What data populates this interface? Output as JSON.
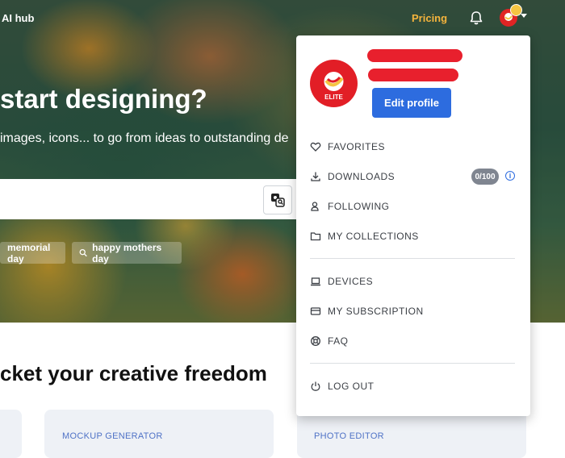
{
  "topbar": {
    "ai_hub": "AI hub",
    "pricing": "Pricing"
  },
  "hero": {
    "headline": "start designing?",
    "subhead": "images, icons... to go from ideas to outstanding de",
    "tags": [
      "memorial day",
      "happy mothers day"
    ]
  },
  "section": {
    "title": "cket your creative freedom",
    "cards": [
      "MOCKUP GENERATOR",
      "PHOTO EDITOR"
    ]
  },
  "profile_menu": {
    "logo_text": "ELITE",
    "edit_profile": "Edit profile",
    "items": {
      "favorites": "FAVORITES",
      "downloads": "DOWNLOADS",
      "downloads_quota": "0/100",
      "following": "FOLLOWING",
      "collections": "MY COLLECTIONS",
      "devices": "DEVICES",
      "subscription": "MY SUBSCRIPTION",
      "faq": "FAQ",
      "logout": "LOG OUT"
    }
  },
  "colors": {
    "accent_blue": "#2d6cdf",
    "pricing_gold": "#f5b43c",
    "brand_red": "#e21e26"
  },
  "icons": [
    "bell-icon",
    "heart-icon",
    "download-icon",
    "user-follow-icon",
    "folder-icon",
    "laptop-icon",
    "credit-card-icon",
    "lifebuoy-icon",
    "power-icon",
    "info-icon",
    "search-icon",
    "image-search-icon",
    "chevron-down-icon",
    "crown-icon"
  ]
}
